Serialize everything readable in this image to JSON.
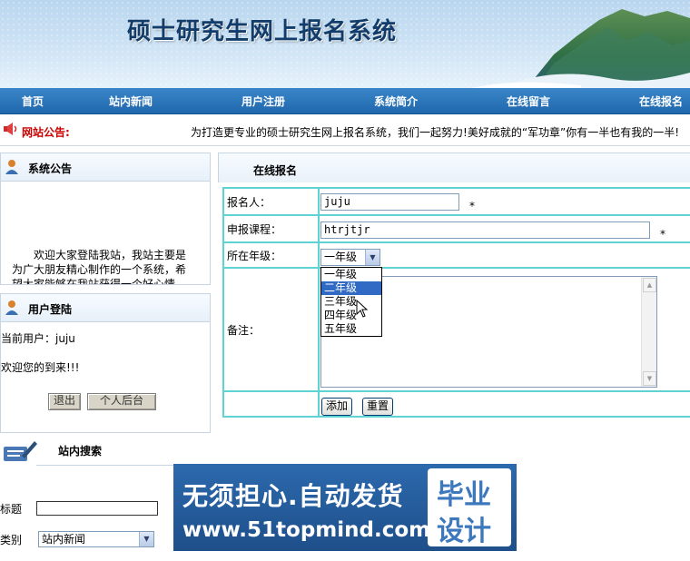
{
  "banner": {
    "title": "硕士研究生网上报名系统"
  },
  "nav": {
    "items": [
      "首页",
      "站内新闻",
      "用户注册",
      "系统简介",
      "在线留言",
      "在线报名"
    ]
  },
  "notice": {
    "label": "网站公告:",
    "text": "为打造更专业的硕士研究生网上报名系统，我们一起努力!美好成就的“军功章”你有一半也有我的一半!"
  },
  "sys_notice": {
    "title": "系统公告",
    "body": "欢迎大家登陆我站，我站主要是为广大朋友精心制作的一个系统，希望大家能够在我站获得一个好心情"
  },
  "login": {
    "title": "用户登陆",
    "current_user": "当前用户：juju",
    "welcome": "欢迎您的到来!!!",
    "logout_label": "退出",
    "admin_label": "个人后台"
  },
  "search": {
    "title": "站内搜索",
    "field_title_label": "标题",
    "field_title_value": "",
    "category_label": "类别",
    "category_value": "站内新闻"
  },
  "form": {
    "title": "在线报名",
    "applicant_label": "报名人：",
    "applicant_value": "juju",
    "course_label": "申报课程：",
    "course_value": "htrjtjr",
    "grade_label": "所在年级：",
    "grade_value": "一年级",
    "grade_options": [
      "一年级",
      "二年级",
      "三年级",
      "四年级",
      "五年级"
    ],
    "grade_highlighted": "二年级",
    "remark_label": "备注：",
    "remark_value": "",
    "required_mark": "*",
    "add_label": "添加",
    "reset_label": "重置"
  },
  "watermark": {
    "line1": "无须担心.自动发货",
    "line2": "www.51topmind.com",
    "stamp1": "毕业",
    "stamp2": "设计"
  },
  "colors": {
    "nav": "#2a78bf",
    "notice_label": "#cc0000",
    "table_border": "#5fd3d3",
    "highlight": "#316ac5",
    "watermark_bg": "#255e9d"
  }
}
